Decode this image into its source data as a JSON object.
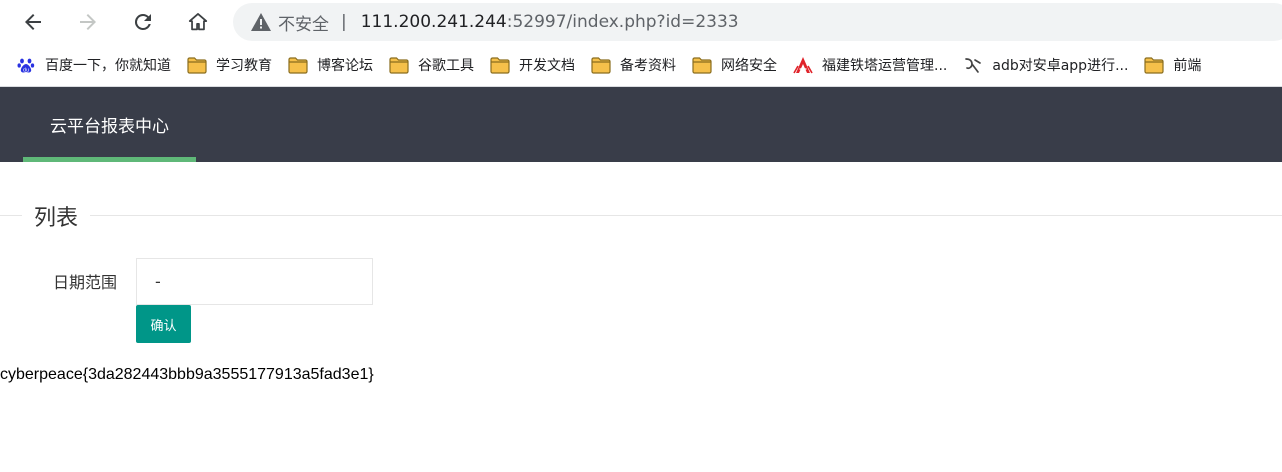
{
  "browser": {
    "address_bar": {
      "security_label": "不安全",
      "separator": "|",
      "host": "111.200.241.244",
      "path": ":52997/index.php?id=2333"
    },
    "icons": {
      "back": "back-arrow-icon",
      "forward": "forward-arrow-icon",
      "reload": "reload-icon",
      "home": "home-icon",
      "warning": "warning-triangle-icon"
    },
    "bookmarks": [
      {
        "label": "百度一下，你就知道",
        "icon": "baidu-paw-icon"
      },
      {
        "label": "学习教育",
        "icon": "folder-icon"
      },
      {
        "label": "博客论坛",
        "icon": "folder-icon"
      },
      {
        "label": "谷歌工具",
        "icon": "folder-icon"
      },
      {
        "label": "开发文档",
        "icon": "folder-icon"
      },
      {
        "label": "备考资料",
        "icon": "folder-icon"
      },
      {
        "label": "网络安全",
        "icon": "folder-icon"
      },
      {
        "label": "福建铁塔运营管理...",
        "icon": "tower-logo-icon"
      },
      {
        "label": "adb对安卓app进行...",
        "icon": "adb-site-icon"
      },
      {
        "label": "前端",
        "icon": "folder-icon"
      }
    ]
  },
  "app": {
    "nav_tab": "云平台报表中心",
    "section_title": "列表",
    "form": {
      "date_label": "日期范围",
      "date_value": "-",
      "confirm_label": "确认"
    },
    "output_text": "cyberpeace{3da282443bbb9a3555177913a5fad3e1}"
  },
  "colors": {
    "header_bg": "#393d49",
    "tab_underline": "#5fb878",
    "button_bg": "#009688",
    "folder": "#f5c04a"
  }
}
